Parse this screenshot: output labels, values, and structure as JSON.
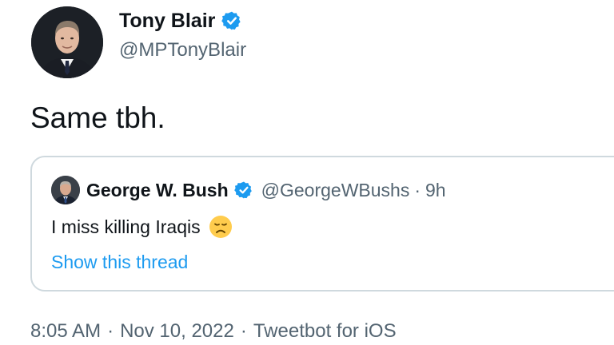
{
  "author": {
    "name": "Tony Blair",
    "handle": "@MPTonyBlair",
    "verified": true
  },
  "tweet": {
    "text": "Same tbh."
  },
  "quoted_tweet": {
    "author_name": "George W. Bush",
    "author_handle": "@GeorgeWBushs",
    "separator": "·",
    "time_ago": "9h",
    "text": "I miss killing Iraqis",
    "emoji": "disappointed-face-emoji",
    "show_thread_label": "Show this thread"
  },
  "meta": {
    "time": "8:05 AM",
    "date": "Nov 10, 2022",
    "source": "Tweetbot for iOS",
    "separator": "·"
  },
  "colors": {
    "verified_blue": "#1d9bf0",
    "link_blue": "#1d9bf0",
    "secondary_text": "#536471",
    "primary_text": "#0f1419",
    "card_border": "#cfd9de"
  }
}
